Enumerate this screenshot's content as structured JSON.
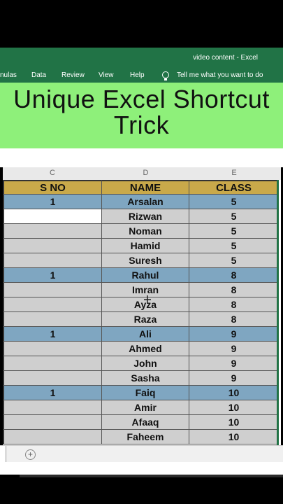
{
  "app": {
    "title": "video content  -  Excel"
  },
  "ribbon": {
    "tabs": [
      "nulas",
      "Data",
      "Review",
      "View",
      "Help"
    ],
    "tell_me": "Tell me what you want to do"
  },
  "banner": {
    "line1": "Unique Excel Shortcut",
    "line2": "Trick"
  },
  "columns": [
    "C",
    "D",
    "E"
  ],
  "table": {
    "headers": [
      "S NO",
      "NAME",
      "CLASS"
    ],
    "rows": [
      {
        "sno": "1",
        "name": "Arsalan",
        "class": "5"
      },
      {
        "sno": "",
        "name": "Rizwan",
        "class": "5"
      },
      {
        "sno": "",
        "name": "Noman",
        "class": "5"
      },
      {
        "sno": "",
        "name": "Hamid",
        "class": "5"
      },
      {
        "sno": "",
        "name": "Suresh",
        "class": "5"
      },
      {
        "sno": "1",
        "name": "Rahul",
        "class": "8"
      },
      {
        "sno": "",
        "name": "Imran",
        "class": "8"
      },
      {
        "sno": "",
        "name": "Ayza",
        "class": "8"
      },
      {
        "sno": "",
        "name": "Raza",
        "class": "8"
      },
      {
        "sno": "1",
        "name": "Ali",
        "class": "9"
      },
      {
        "sno": "",
        "name": "Ahmed",
        "class": "9"
      },
      {
        "sno": "",
        "name": "John",
        "class": "9"
      },
      {
        "sno": "",
        "name": "Sasha",
        "class": "9"
      },
      {
        "sno": "1",
        "name": "Faiq",
        "class": "10"
      },
      {
        "sno": "",
        "name": "Amir",
        "class": "10"
      },
      {
        "sno": "",
        "name": "Afaaq",
        "class": "10"
      },
      {
        "sno": "",
        "name": "Faheem",
        "class": "10"
      }
    ]
  },
  "sheet": {
    "add_sheet_icon": "plus-icon",
    "add_symbol": "+"
  },
  "colors": {
    "ribbon": "#217346",
    "banner": "#8ef07a",
    "header": "#c9a94a",
    "group_row": "#7fa6c1",
    "data_row": "#cfcfcf"
  }
}
